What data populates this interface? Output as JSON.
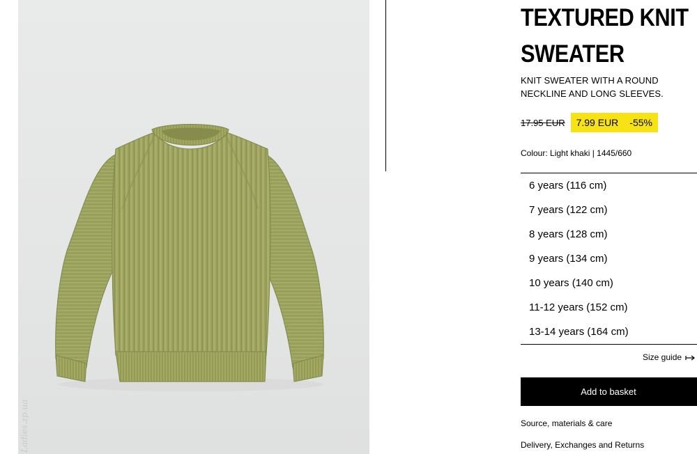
{
  "product": {
    "title_line1": "TEXTURED KNIT",
    "title_line2": "SWEATER",
    "description": "KNIT SWEATER WITH A ROUND NECKLINE AND LONG SLEEVES.",
    "old_price": "17.95 EUR",
    "new_price": "7.99 EUR",
    "discount": "-55%",
    "colour_label": "Colour: Light khaki | 1445/660",
    "image_alt": "sweater-photo"
  },
  "watermark": "Ladies.zp.ua",
  "sizes": [
    "6 years (116 cm)",
    "7 years (122 cm)",
    "8 years (128 cm)",
    "9 years (134 cm)",
    "10 years (140 cm)",
    "11-12 years (152 cm)",
    "13-14 years (164 cm)"
  ],
  "size_guide": "Size guide",
  "size_guide_icon": "arrows-horizontal-icon",
  "add_to_basket": "Add to basket",
  "links": {
    "source": "Source, materials & care",
    "delivery": "Delivery, Exchanges and Returns"
  },
  "colors": {
    "highlight": "#f7e214",
    "button": "#000000",
    "sweater": "#9aa25a",
    "photo_bg": "#e6e7e7"
  }
}
